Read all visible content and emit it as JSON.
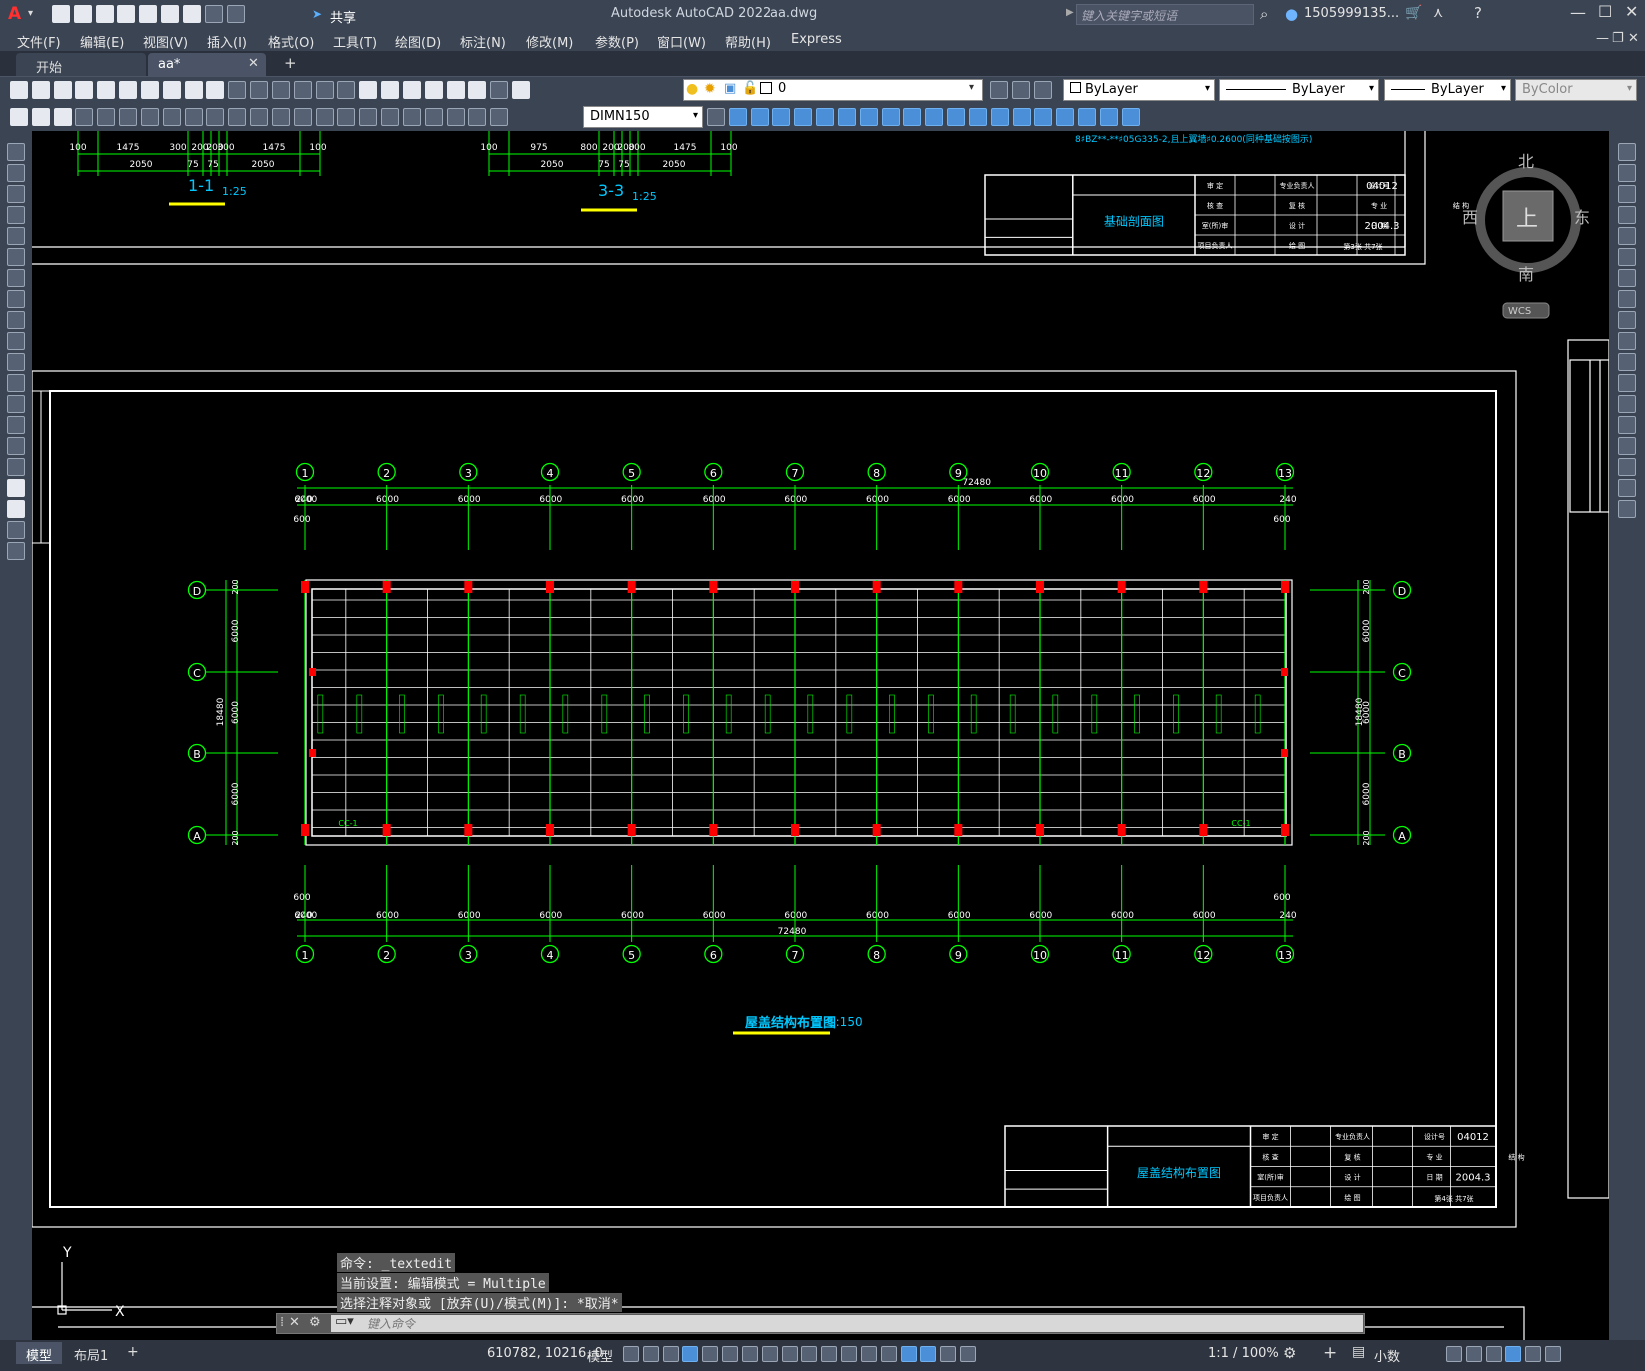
{
  "app": {
    "title": "Autodesk AutoCAD 2022",
    "filename": "aa.dwg",
    "share_label": "共享",
    "search_placeholder": "键入关键字或短语",
    "user": "1505999135...",
    "logo": "A"
  },
  "menu": [
    "文件(F)",
    "编辑(E)",
    "视图(V)",
    "插入(I)",
    "格式(O)",
    "工具(T)",
    "绘图(D)",
    "标注(N)",
    "修改(M)",
    "参数(P)",
    "窗口(W)",
    "帮助(H)",
    "Express"
  ],
  "tabs": [
    {
      "label": "开始"
    },
    {
      "label": "aa*",
      "close": "✕"
    },
    {
      "label": "+"
    }
  ],
  "toolbar": {
    "layer": "0",
    "color": "ByLayer",
    "linetype": "ByLayer",
    "lineweight": "ByLayer",
    "plotstyle": "ByColor",
    "dimstyle": "DIMN150"
  },
  "viewcube": {
    "north": "北",
    "south": "南",
    "east": "东",
    "west": "西",
    "top": "上",
    "wcs": "WCS"
  },
  "drawing": {
    "section_1": "1-1",
    "section_3": "3-3",
    "scale_125": "1:25",
    "plan_title": "屋盖结构布置图",
    "plan_scale": "1:150",
    "top_title": "基础剖面图",
    "top_note": "8♯BZ**-**♯05G335-2,且上翼墙♯0.2600(同种基础按图示)",
    "total_dim": "72480",
    "bay_dim": "6000",
    "edge_dim": "240",
    "end_dim": "600",
    "height_total": "18480",
    "height_edge": "200",
    "grid_numbers": [
      "1",
      "2",
      "3",
      "4",
      "5",
      "6",
      "7",
      "8",
      "9",
      "10",
      "11",
      "12",
      "13"
    ],
    "grid_letters": [
      "A",
      "B",
      "C",
      "D"
    ],
    "sec1_dims": [
      "100",
      "1475",
      "300",
      "200",
      "200",
      "300",
      "1475",
      "100",
      "2050",
      "75",
      "75",
      "2050"
    ],
    "sec3_dims": [
      "100",
      "975",
      "800",
      "200",
      "200",
      "800",
      "1475",
      "100",
      "2050",
      "75",
      "75",
      "2050"
    ],
    "cc_label": "CC-1",
    "titleblock": {
      "code": "04012",
      "date": "2004.3",
      "sheet_top": "第3张 共7张",
      "sheet_bottom": "第4张 共7张",
      "cells_a": [
        "审 定",
        "专业负责人",
        "设计号"
      ],
      "cells_b": [
        "核 查",
        "复 核",
        "专 业",
        "结 构"
      ],
      "cells_c": [
        "室(所)审",
        "设 计",
        "日 期"
      ],
      "cells_d": [
        "项目负责人",
        "绘 图"
      ]
    }
  },
  "ucs": {
    "x": "X",
    "y": "Y"
  },
  "command": {
    "line1": "命令: _textedit",
    "line2": "当前设置: 编辑模式 = Multiple",
    "line3": "选择注释对象或 [放弃(U)/模式(M)]: *取消*",
    "placeholder": "键入命令"
  },
  "status": {
    "model_tab": "模型",
    "layout_tab": "布局1",
    "add_tab": "+",
    "coords": "610782, 10216, 0",
    "space": "模型",
    "scale": "1:1 / 100%",
    "units": "小数"
  },
  "colors": {
    "chrome": "#3b4453",
    "canvas": "#000000",
    "grid_green": "#00ff00",
    "column_red": "#ff0000",
    "title_cyan": "#00c8ff",
    "underline_yellow": "#ffff00"
  }
}
